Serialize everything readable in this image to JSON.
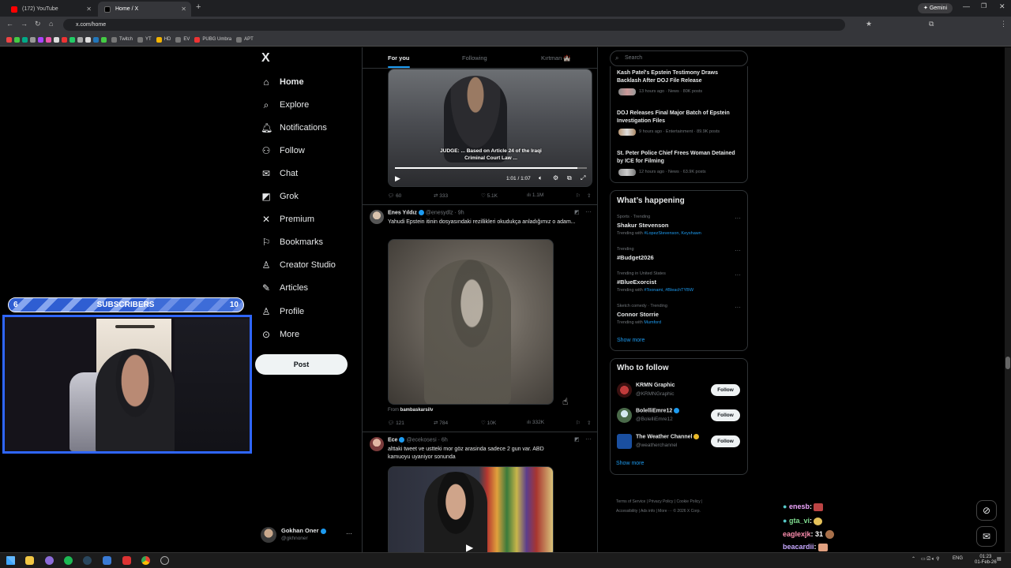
{
  "browser": {
    "tabs": [
      {
        "title": "(172) YouTube"
      },
      {
        "title": "Home / X"
      }
    ],
    "new_tab": "+",
    "gemini": "Gemini",
    "url": "x.com/home",
    "bookmarks": [
      "Twitch",
      "YT",
      "HD",
      "EV",
      "PUBG Umbra",
      "APT"
    ]
  },
  "x_nav": {
    "logo": "X",
    "items": [
      {
        "label": "Home",
        "icon": "home-icon"
      },
      {
        "label": "Explore",
        "icon": "search-icon"
      },
      {
        "label": "Notifications",
        "icon": "bell-icon"
      },
      {
        "label": "Follow",
        "icon": "person-add-icon"
      },
      {
        "label": "Chat",
        "icon": "mail-icon"
      },
      {
        "label": "Grok",
        "icon": "grok-icon"
      },
      {
        "label": "Premium",
        "icon": "x-icon"
      },
      {
        "label": "Bookmarks",
        "icon": "bookmark-icon"
      },
      {
        "label": "Creator Studio",
        "icon": "creator-icon"
      },
      {
        "label": "Articles",
        "icon": "article-icon"
      },
      {
        "label": "Profile",
        "icon": "person-icon"
      },
      {
        "label": "More",
        "icon": "more-icon"
      }
    ],
    "post_label": "Post",
    "account": {
      "name": "Gokhan Oner",
      "handle": "@gkhnoner",
      "menu": "···"
    }
  },
  "feed": {
    "tabs": [
      "For you",
      "Following",
      "Kırtman 🏰"
    ],
    "tweet1": {
      "caption_line1": "JUDGE: ... Based on Article 24 of the Iraqi",
      "caption_line2": "Criminal Court Law ...",
      "time": "1:01 / 1:07",
      "replies": "60",
      "reposts": "333",
      "likes": "5.1K",
      "views": "1.1M"
    },
    "tweet2": {
      "name": "Enes Yıldız",
      "handle": "@enesydlz",
      "time": "· 9h",
      "text": "Yahudi Epstein itinin dosyasındaki rezillikleri okudukça anladığımız o adam...",
      "from_label": "From",
      "from_user": "bambaskarsilv",
      "replies": "121",
      "reposts": "784",
      "likes": "10K",
      "views": "332K"
    },
    "tweet3": {
      "name": "Ece",
      "handle": "@ecekosesi",
      "time": "· 6h",
      "text": "alttaki tweet ve ustteki mor göz arasinda sadece 2 gun var. ABD kamuoyu uyaniyor sonunda"
    }
  },
  "sidebar": {
    "search_placeholder": "Search",
    "news": [
      {
        "title": "Kash Patel's Epstein Testimony Draws Backlash After DOJ File Release",
        "meta": "13 hours ago · News · 80K posts"
      },
      {
        "title": "DOJ Releases Final Major Batch of Epstein Investigation Files",
        "meta": "9 hours ago · Entertainment · 89.9K posts"
      },
      {
        "title": "St. Peter Police Chief Frees Woman Detained by ICE for Filming",
        "meta": "12 hours ago · News · 63.9K posts"
      }
    ],
    "happening_title": "What’s happening",
    "trends": [
      {
        "category": "Sports · Trending",
        "name": "Shakur Stevenson",
        "with_prefix": "Trending with",
        "with": "#LopezStevenson, Keyshawn"
      },
      {
        "category": "Trending",
        "name": "#Budget2026",
        "with_prefix": "",
        "with": ""
      },
      {
        "category": "Trending in United States",
        "name": "#BlueExorcist",
        "with_prefix": "Trending with",
        "with": "#Toonami, #BleachTYBW"
      },
      {
        "category": "Sketch comedy · Trending",
        "name": "Connor Storrie",
        "with_prefix": "Trending with",
        "with": "Mumford"
      }
    ],
    "show_more": "Show more",
    "wtf_title": "Who to follow",
    "wtf": [
      {
        "name": "KRMN Graphic",
        "handle": "@KRMNGraphic",
        "button": "Follow"
      },
      {
        "name": "BolelliEmre12",
        "handle": "@BolelliEmre12",
        "button": "Follow"
      },
      {
        "name": "The Weather Channel",
        "handle": "@weatherchannel",
        "button": "Follow"
      }
    ],
    "footer1": "Terms of Service  |  Privacy Policy  |  Cookie Policy  |",
    "footer2": "Accessibility  |  Ads info  |  More ···  © 2026 X Corp."
  },
  "overlay": {
    "sub_current": "6",
    "sub_label": "SUBSCRIBERS",
    "sub_goal": "10",
    "sub_progress": 0.6
  },
  "chat": [
    {
      "user": "enesb",
      "msg": ":",
      "color": "#f0a6ff"
    },
    {
      "user": "gta_vi",
      "msg": ":",
      "color": "#7fdc8f"
    },
    {
      "user": "eaglexjk",
      "msg": ": 31",
      "color": "#ff8fb0"
    },
    {
      "user": "beacardii",
      "msg": ":",
      "color": "#c7a8ff"
    }
  ],
  "taskbar": {
    "lang": "ENG",
    "time": "01:23",
    "date": "01-Feb-26"
  },
  "colors": {
    "accent": "#1d9bf0",
    "bg": "#000000",
    "border": "#2f3336",
    "webcam_border": "#2f66ff"
  }
}
